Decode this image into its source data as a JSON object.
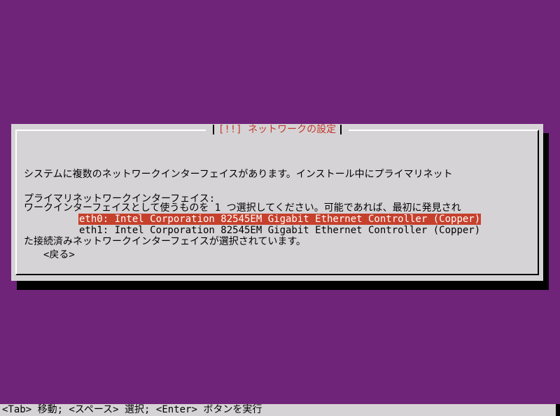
{
  "dialog": {
    "title": "[!!] ネットワークの設定",
    "message_lines": [
      "システムに複数のネットワークインターフェイスがあります。インストール中にプライマリネット",
      "ワークインターフェイスとして使うものを 1 つ選択してください。可能であれば、最初に発見され",
      "た接続済みネットワークインターフェイスが選択されています。"
    ],
    "prompt": "プライマリネットワークインターフェイス:",
    "options": [
      "eth0: Intel Corporation 82545EM Gigabit Ethernet Controller (Copper)",
      "eth1: Intel Corporation 82545EM Gigabit Ethernet Controller (Copper)"
    ],
    "selected_index": 0,
    "back_label": "<戻る>"
  },
  "status_bar": {
    "text": "<Tab> 移動; <スペース> 選択; <Enter> ボタンを実行"
  },
  "colors": {
    "background": "#6f2479",
    "dialog_background": "#d6d3d6",
    "title_text": "#c0392b",
    "selection_background": "#c6412c",
    "selection_text": "#ffffff"
  }
}
